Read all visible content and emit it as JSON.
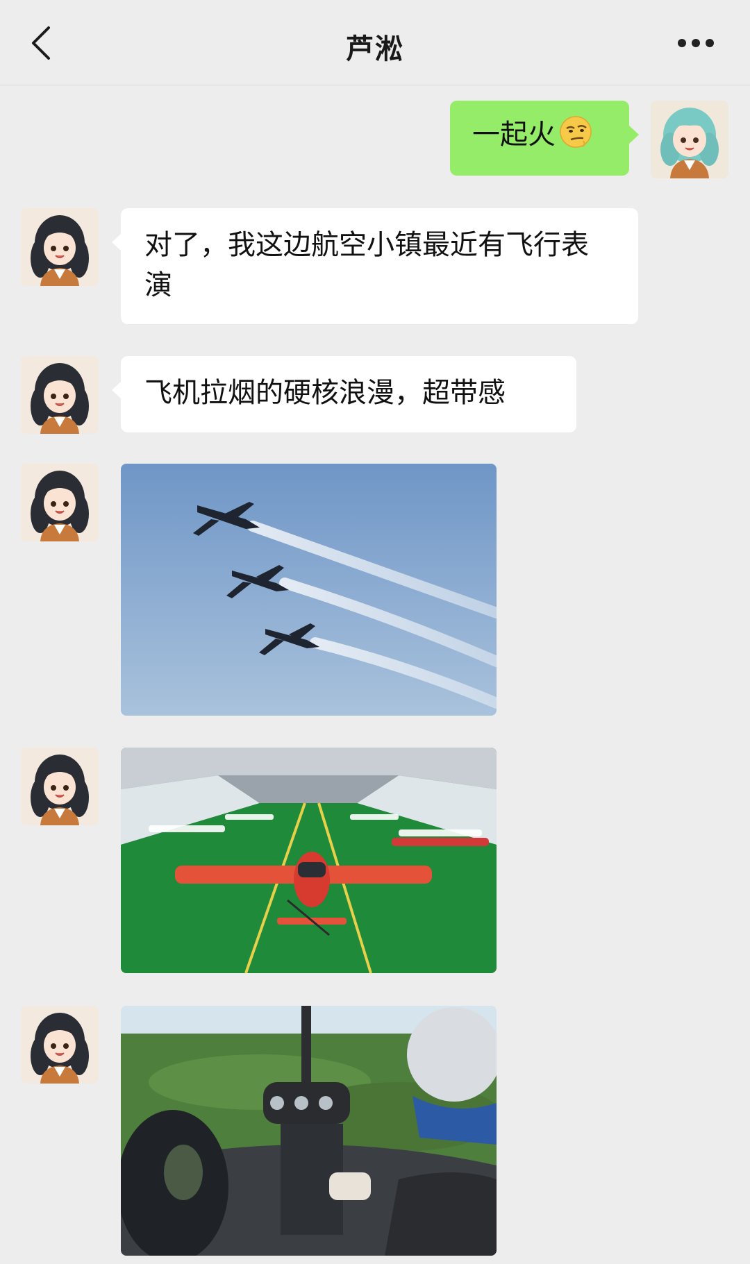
{
  "header": {
    "title": "芦淞"
  },
  "messages": [
    {
      "sender": "me",
      "text": "一起火",
      "emoji": "smirk-emoji"
    },
    {
      "sender": "other",
      "text": "对了，我这边航空小镇最近有飞行表演"
    },
    {
      "sender": "other",
      "text": "飞机拉烟的硬核浪漫，超带感"
    },
    {
      "sender": "other",
      "type": "image",
      "subject": "airplane-formation-photo"
    },
    {
      "sender": "other",
      "type": "image",
      "subject": "aircraft-hangar-photo"
    },
    {
      "sender": "other",
      "type": "image",
      "subject": "helicopter-cockpit-photo"
    }
  ],
  "colors": {
    "background": "#ededed",
    "my_bubble": "#95ec69",
    "their_bubble": "#ffffff"
  }
}
